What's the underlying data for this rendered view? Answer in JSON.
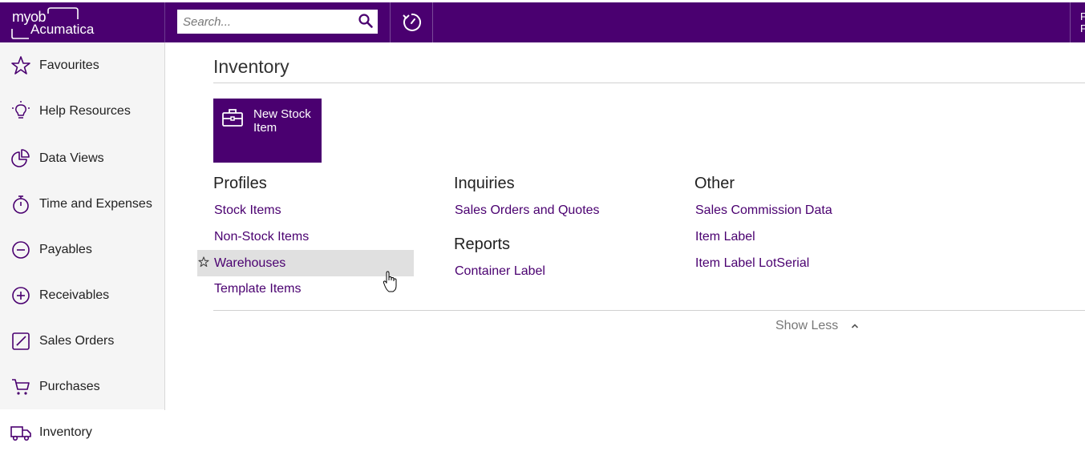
{
  "header": {
    "logo_line1": "myob",
    "logo_line2": "Acumatica",
    "search_placeholder": "Search...",
    "right_text": "F F"
  },
  "sidebar": {
    "items": [
      {
        "label": "Favourites",
        "icon": "star-icon"
      },
      {
        "label": "Help Resources",
        "icon": "lightbulb-icon"
      },
      {
        "label": "Data Views",
        "icon": "pie-chart-icon"
      },
      {
        "label": "Time and Expenses",
        "icon": "stopwatch-icon"
      },
      {
        "label": "Payables",
        "icon": "minus-circle-icon"
      },
      {
        "label": "Receivables",
        "icon": "plus-circle-icon"
      },
      {
        "label": "Sales Orders",
        "icon": "edit-icon"
      },
      {
        "label": "Purchases",
        "icon": "cart-icon"
      },
      {
        "label": "Inventory",
        "icon": "truck-icon"
      }
    ],
    "active": "Inventory"
  },
  "main": {
    "title": "Inventory",
    "tile": {
      "label": "New Stock Item",
      "icon": "briefcase-icon"
    },
    "profiles": {
      "heading": "Profiles",
      "links": [
        "Stock Items",
        "Non-Stock Items",
        "Warehouses",
        "Template Items"
      ]
    },
    "inquiries": {
      "heading": "Inquiries",
      "links": [
        "Sales Orders and Quotes"
      ]
    },
    "reports": {
      "heading": "Reports",
      "links": [
        "Container Label"
      ]
    },
    "other": {
      "heading": "Other",
      "links": [
        "Sales Commission Data",
        "Item Label",
        "Item Label LotSerial"
      ]
    },
    "show_less": "Show Less"
  },
  "colors": {
    "brand": "#4a0070",
    "sidebar_bg": "#f5f5f5",
    "highlight_row": "#e0e0e0"
  }
}
